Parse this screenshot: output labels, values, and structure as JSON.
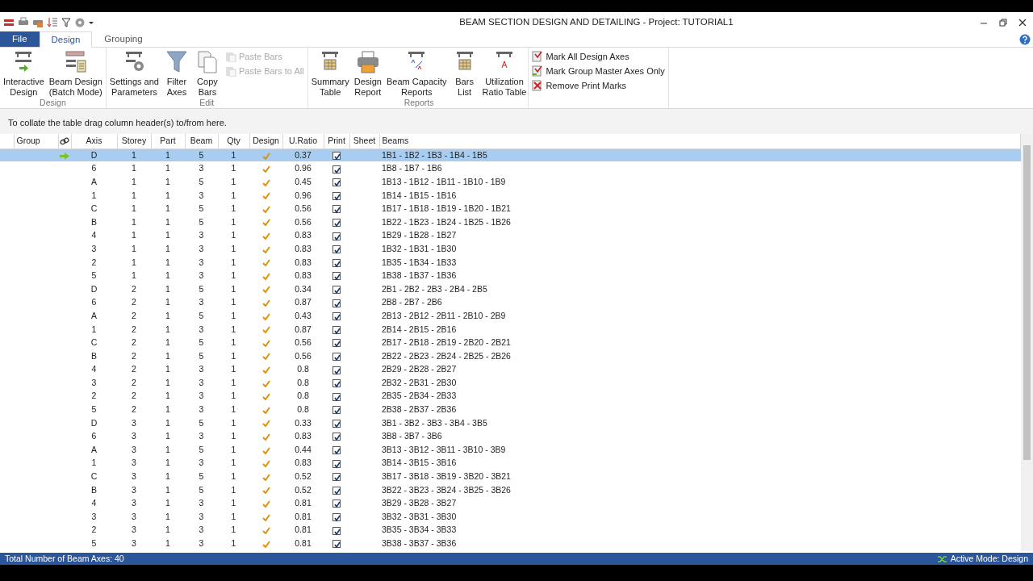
{
  "window": {
    "title": "BEAM SECTION DESIGN AND DETAILING - Project: TUTORIAL1"
  },
  "menu_tabs": [
    {
      "label": "File",
      "kind": "file",
      "selected": false
    },
    {
      "label": "Design",
      "kind": "tab",
      "selected": true
    },
    {
      "label": "Grouping",
      "kind": "tab",
      "selected": false
    }
  ],
  "ribbon_groups": [
    {
      "label": "Design",
      "items": [
        {
          "kind": "large",
          "lines": [
            "Interactive",
            "Design"
          ],
          "disabled": false
        },
        {
          "kind": "large",
          "lines": [
            "Beam Design",
            "(Batch Mode)"
          ],
          "disabled": false
        }
      ]
    },
    {
      "label": "Edit",
      "items": [
        {
          "kind": "large",
          "lines": [
            "Settings and",
            "Parameters"
          ],
          "disabled": false
        },
        {
          "kind": "large",
          "lines": [
            "Filter",
            "Axes"
          ],
          "disabled": false
        },
        {
          "kind": "large",
          "lines": [
            "Copy",
            "Bars"
          ],
          "disabled": false
        },
        {
          "kind": "small",
          "lines": [
            "Paste Bars"
          ],
          "disabled": true
        },
        {
          "kind": "small",
          "lines": [
            "Paste Bars to All"
          ],
          "disabled": true
        }
      ]
    },
    {
      "label": "Reports",
      "items": [
        {
          "kind": "large",
          "lines": [
            "Summary",
            "Table"
          ],
          "disabled": false
        },
        {
          "kind": "large",
          "lines": [
            "Design",
            "Report"
          ],
          "disabled": false
        },
        {
          "kind": "large",
          "lines": [
            "Beam Capacity",
            "Reports"
          ],
          "disabled": false
        },
        {
          "kind": "large",
          "lines": [
            "Bars",
            "List"
          ],
          "disabled": false
        },
        {
          "kind": "large",
          "lines": [
            "Utilization",
            "Ratio Table"
          ],
          "disabled": false
        }
      ]
    },
    {
      "items": [
        {
          "kind": "small",
          "lines": [
            "Mark All Design Axes"
          ],
          "disabled": false
        },
        {
          "kind": "small",
          "lines": [
            "Mark Group Master Axes Only"
          ],
          "disabled": false
        },
        {
          "kind": "small",
          "lines": [
            "Remove Print Marks"
          ],
          "disabled": false
        }
      ]
    }
  ],
  "group_panel": {
    "hint": "To collate the table drag column header(s) to/from here."
  },
  "table": {
    "columns": [
      "Group",
      "Axis",
      "Storey",
      "Part",
      "Beam",
      "Qty",
      "Design",
      "U.Ratio",
      "Print",
      "Sheet",
      "Beams"
    ],
    "rows": [
      {
        "selected": true,
        "current": true,
        "axis": "D",
        "storey": "1",
        "part": "1",
        "beam": "5",
        "qty": "1",
        "designed": true,
        "ratio": "0.37",
        "print": true,
        "beams": "1B1 - 1B2 - 1B3 - 1B4 - 1B5"
      },
      {
        "selected": false,
        "current": false,
        "axis": "6",
        "storey": "1",
        "part": "1",
        "beam": "3",
        "qty": "1",
        "designed": true,
        "ratio": "0.96",
        "print": true,
        "beams": "1B8 - 1B7 - 1B6"
      },
      {
        "selected": false,
        "current": false,
        "axis": "A",
        "storey": "1",
        "part": "1",
        "beam": "5",
        "qty": "1",
        "designed": true,
        "ratio": "0.45",
        "print": true,
        "beams": "1B13 - 1B12 - 1B11 - 1B10 - 1B9"
      },
      {
        "selected": false,
        "current": false,
        "axis": "1",
        "storey": "1",
        "part": "1",
        "beam": "3",
        "qty": "1",
        "designed": true,
        "ratio": "0.96",
        "print": true,
        "beams": "1B14 - 1B15 - 1B16"
      },
      {
        "selected": false,
        "current": false,
        "axis": "C",
        "storey": "1",
        "part": "1",
        "beam": "5",
        "qty": "1",
        "designed": true,
        "ratio": "0.56",
        "print": true,
        "beams": "1B17 - 1B18 - 1B19 - 1B20 - 1B21"
      },
      {
        "selected": false,
        "current": false,
        "axis": "B",
        "storey": "1",
        "part": "1",
        "beam": "5",
        "qty": "1",
        "designed": true,
        "ratio": "0.56",
        "print": true,
        "beams": "1B22 - 1B23 - 1B24 - 1B25 - 1B26"
      },
      {
        "selected": false,
        "current": false,
        "axis": "4",
        "storey": "1",
        "part": "1",
        "beam": "3",
        "qty": "1",
        "designed": true,
        "ratio": "0.83",
        "print": true,
        "beams": "1B29 - 1B28 - 1B27"
      },
      {
        "selected": false,
        "current": false,
        "axis": "3",
        "storey": "1",
        "part": "1",
        "beam": "3",
        "qty": "1",
        "designed": true,
        "ratio": "0.83",
        "print": true,
        "beams": "1B32 - 1B31 - 1B30"
      },
      {
        "selected": false,
        "current": false,
        "axis": "2",
        "storey": "1",
        "part": "1",
        "beam": "3",
        "qty": "1",
        "designed": true,
        "ratio": "0.83",
        "print": true,
        "beams": "1B35 - 1B34 - 1B33"
      },
      {
        "selected": false,
        "current": false,
        "axis": "5",
        "storey": "1",
        "part": "1",
        "beam": "3",
        "qty": "1",
        "designed": true,
        "ratio": "0.83",
        "print": true,
        "beams": "1B38 - 1B37 - 1B36"
      },
      {
        "selected": false,
        "current": false,
        "axis": "D",
        "storey": "2",
        "part": "1",
        "beam": "5",
        "qty": "1",
        "designed": true,
        "ratio": "0.34",
        "print": true,
        "beams": "2B1 - 2B2 - 2B3 - 2B4 - 2B5"
      },
      {
        "selected": false,
        "current": false,
        "axis": "6",
        "storey": "2",
        "part": "1",
        "beam": "3",
        "qty": "1",
        "designed": true,
        "ratio": "0.87",
        "print": true,
        "beams": "2B8 - 2B7 - 2B6"
      },
      {
        "selected": false,
        "current": false,
        "axis": "A",
        "storey": "2",
        "part": "1",
        "beam": "5",
        "qty": "1",
        "designed": true,
        "ratio": "0.43",
        "print": true,
        "beams": "2B13 - 2B12 - 2B11 - 2B10 - 2B9"
      },
      {
        "selected": false,
        "current": false,
        "axis": "1",
        "storey": "2",
        "part": "1",
        "beam": "3",
        "qty": "1",
        "designed": true,
        "ratio": "0.87",
        "print": true,
        "beams": "2B14 - 2B15 - 2B16"
      },
      {
        "selected": false,
        "current": false,
        "axis": "C",
        "storey": "2",
        "part": "1",
        "beam": "5",
        "qty": "1",
        "designed": true,
        "ratio": "0.56",
        "print": true,
        "beams": "2B17 - 2B18 - 2B19 - 2B20 - 2B21"
      },
      {
        "selected": false,
        "current": false,
        "axis": "B",
        "storey": "2",
        "part": "1",
        "beam": "5",
        "qty": "1",
        "designed": true,
        "ratio": "0.56",
        "print": true,
        "beams": "2B22 - 2B23 - 2B24 - 2B25 - 2B26"
      },
      {
        "selected": false,
        "current": false,
        "axis": "4",
        "storey": "2",
        "part": "1",
        "beam": "3",
        "qty": "1",
        "designed": true,
        "ratio": "0.8",
        "print": true,
        "beams": "2B29 - 2B28 - 2B27"
      },
      {
        "selected": false,
        "current": false,
        "axis": "3",
        "storey": "2",
        "part": "1",
        "beam": "3",
        "qty": "1",
        "designed": true,
        "ratio": "0.8",
        "print": true,
        "beams": "2B32 - 2B31 - 2B30"
      },
      {
        "selected": false,
        "current": false,
        "axis": "2",
        "storey": "2",
        "part": "1",
        "beam": "3",
        "qty": "1",
        "designed": true,
        "ratio": "0.8",
        "print": true,
        "beams": "2B35 - 2B34 - 2B33"
      },
      {
        "selected": false,
        "current": false,
        "axis": "5",
        "storey": "2",
        "part": "1",
        "beam": "3",
        "qty": "1",
        "designed": true,
        "ratio": "0.8",
        "print": true,
        "beams": "2B38 - 2B37 - 2B36"
      },
      {
        "selected": false,
        "current": false,
        "axis": "D",
        "storey": "3",
        "part": "1",
        "beam": "5",
        "qty": "1",
        "designed": true,
        "ratio": "0.33",
        "print": true,
        "beams": "3B1 - 3B2 - 3B3 - 3B4 - 3B5"
      },
      {
        "selected": false,
        "current": false,
        "axis": "6",
        "storey": "3",
        "part": "1",
        "beam": "3",
        "qty": "1",
        "designed": true,
        "ratio": "0.83",
        "print": true,
        "beams": "3B8 - 3B7 - 3B6"
      },
      {
        "selected": false,
        "current": false,
        "axis": "A",
        "storey": "3",
        "part": "1",
        "beam": "5",
        "qty": "1",
        "designed": true,
        "ratio": "0.44",
        "print": true,
        "beams": "3B13 - 3B12 - 3B11 - 3B10 - 3B9"
      },
      {
        "selected": false,
        "current": false,
        "axis": "1",
        "storey": "3",
        "part": "1",
        "beam": "3",
        "qty": "1",
        "designed": true,
        "ratio": "0.83",
        "print": true,
        "beams": "3B14 - 3B15 - 3B16"
      },
      {
        "selected": false,
        "current": false,
        "axis": "C",
        "storey": "3",
        "part": "1",
        "beam": "5",
        "qty": "1",
        "designed": true,
        "ratio": "0.52",
        "print": true,
        "beams": "3B17 - 3B18 - 3B19 - 3B20 - 3B21"
      },
      {
        "selected": false,
        "current": false,
        "axis": "B",
        "storey": "3",
        "part": "1",
        "beam": "5",
        "qty": "1",
        "designed": true,
        "ratio": "0.52",
        "print": true,
        "beams": "3B22 - 3B23 - 3B24 - 3B25 - 3B26"
      },
      {
        "selected": false,
        "current": false,
        "axis": "4",
        "storey": "3",
        "part": "1",
        "beam": "3",
        "qty": "1",
        "designed": true,
        "ratio": "0.81",
        "print": true,
        "beams": "3B29 - 3B28 - 3B27"
      },
      {
        "selected": false,
        "current": false,
        "axis": "3",
        "storey": "3",
        "part": "1",
        "beam": "3",
        "qty": "1",
        "designed": true,
        "ratio": "0.81",
        "print": true,
        "beams": "3B32 - 3B31 - 3B30"
      },
      {
        "selected": false,
        "current": false,
        "axis": "2",
        "storey": "3",
        "part": "1",
        "beam": "3",
        "qty": "1",
        "designed": true,
        "ratio": "0.81",
        "print": true,
        "beams": "3B35 - 3B34 - 3B33"
      },
      {
        "selected": false,
        "current": false,
        "axis": "5",
        "storey": "3",
        "part": "1",
        "beam": "3",
        "qty": "1",
        "designed": true,
        "ratio": "0.81",
        "print": true,
        "beams": "3B38 - 3B37 - 3B36"
      }
    ]
  },
  "status_bar": {
    "left": "Total Number of Beam Axes: 40",
    "right": "Active Mode: Design"
  }
}
